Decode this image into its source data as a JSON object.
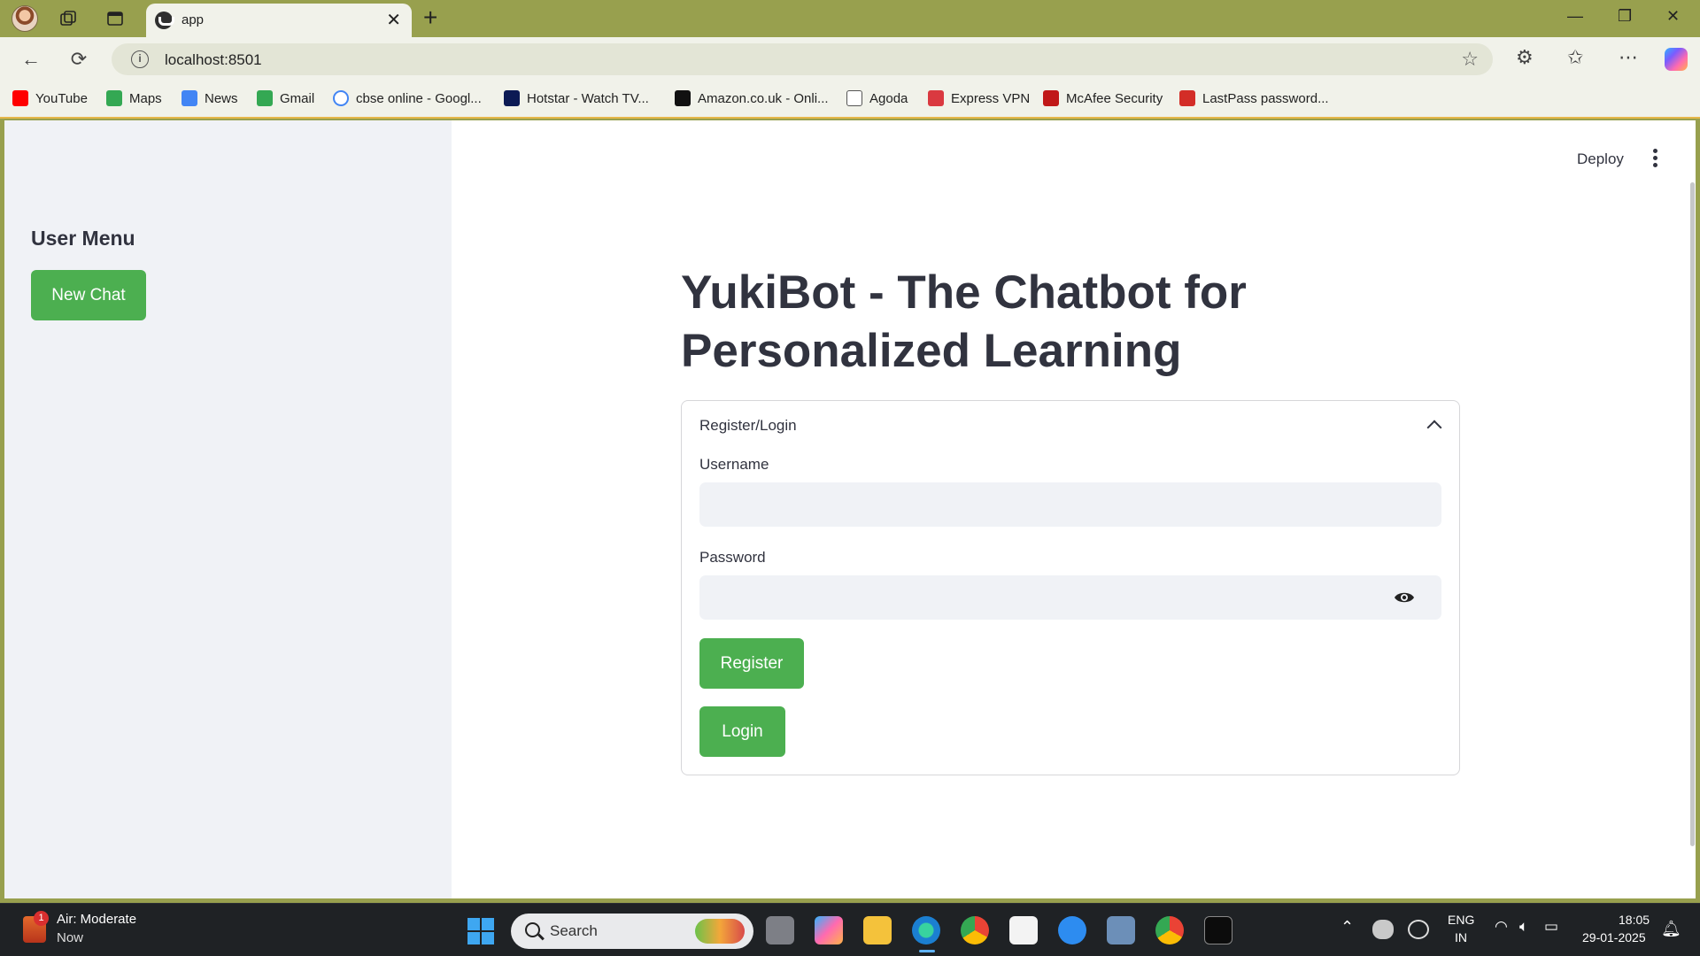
{
  "browser": {
    "tab_title": "app",
    "url": "localhost:8501"
  },
  "bookmarks": [
    {
      "label": "YouTube",
      "color": "#ff0000"
    },
    {
      "label": "Maps",
      "color": "#34a853"
    },
    {
      "label": "News",
      "color": "#4285f4"
    },
    {
      "label": "Gmail",
      "color": "#34a853"
    },
    {
      "label": "cbse online - Googl...",
      "color": "#4285f4"
    },
    {
      "label": "Hotstar - Watch TV...",
      "color": "#0c1a54"
    },
    {
      "label": "Amazon.co.uk - Onli...",
      "color": "#111111"
    },
    {
      "label": "Agoda",
      "color": "#555555"
    },
    {
      "label": "Express VPN",
      "color": "#da3940"
    },
    {
      "label": "McAfee Security",
      "color": "#c01818"
    },
    {
      "label": "LastPass password...",
      "color": "#d32d27"
    }
  ],
  "sidebar": {
    "title": "User Menu",
    "new_chat_label": "New Chat"
  },
  "header": {
    "deploy_label": "Deploy"
  },
  "main": {
    "heading": "YukiBot - The Chatbot for Personalized Learning",
    "expander_label": "Register/Login",
    "username_label": "Username",
    "password_label": "Password",
    "register_label": "Register",
    "login_label": "Login"
  },
  "taskbar": {
    "weather_title": "Air: Moderate",
    "weather_sub": "Now",
    "weather_badge": "1",
    "search_placeholder": "Search",
    "lang_top": "ENG",
    "lang_bottom": "IN",
    "time": "18:05",
    "date": "29-01-2025"
  },
  "colors": {
    "accent": "#4caf50",
    "browser_frame": "#98a04e",
    "sidebar_bg": "#f0f2f6"
  }
}
